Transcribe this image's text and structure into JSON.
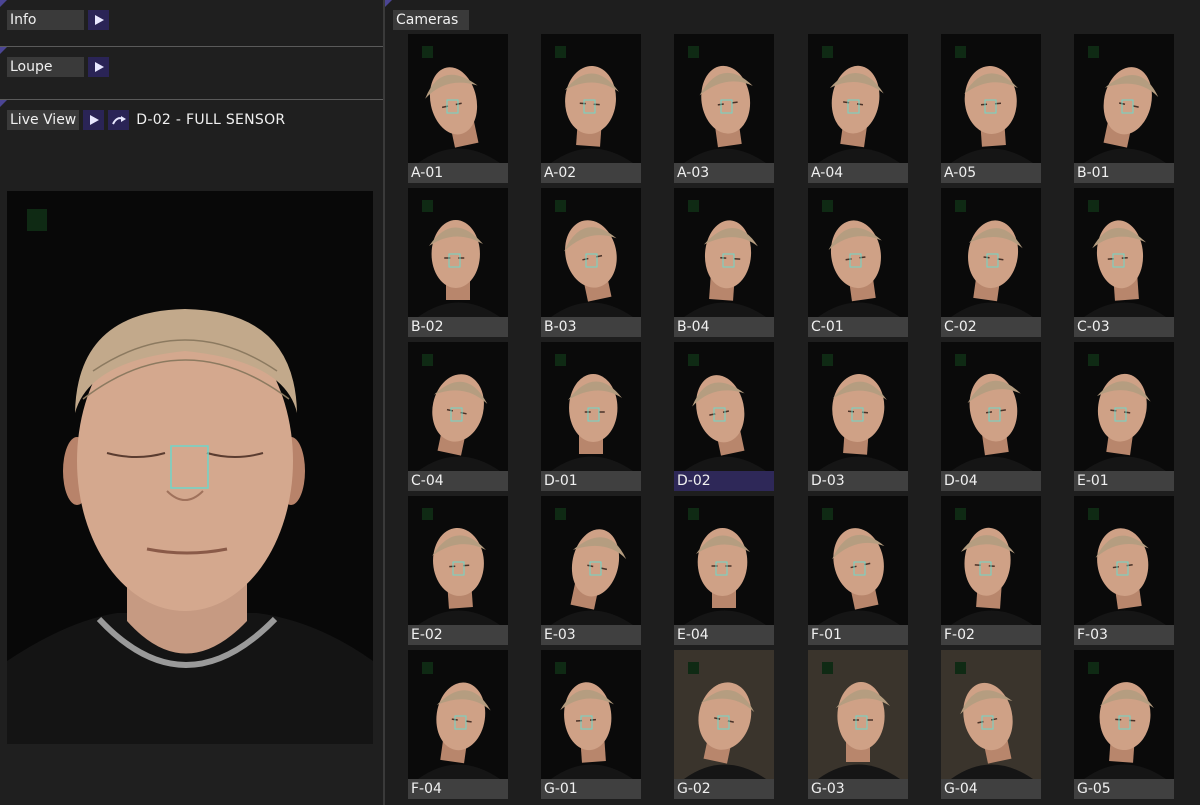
{
  "panels": {
    "info": {
      "label": "Info"
    },
    "loupe": {
      "label": "Loupe"
    },
    "live_view": {
      "label": "Live View",
      "status": "D-02 - FULL SENSOR"
    }
  },
  "cameras": {
    "title": "Cameras",
    "selected": "D-02",
    "ids": [
      "A-01",
      "A-02",
      "A-03",
      "A-04",
      "A-05",
      "B-01",
      "B-02",
      "B-03",
      "B-04",
      "C-01",
      "C-02",
      "C-03",
      "C-04",
      "D-01",
      "D-02",
      "D-03",
      "D-04",
      "E-01",
      "E-02",
      "E-03",
      "E-04",
      "F-01",
      "F-02",
      "F-03",
      "F-04",
      "G-01",
      "G-02",
      "G-03",
      "G-04",
      "G-05"
    ]
  },
  "colors": {
    "accent": "#4b4594",
    "button_bg": "#2a2456",
    "selected_caption": "#2e2858",
    "caption_bg": "#404040",
    "focus_box": "#6fd6c8"
  },
  "icons": {
    "play": "play-icon",
    "refresh": "rotate-icon",
    "focus": "focus-box-icon"
  }
}
